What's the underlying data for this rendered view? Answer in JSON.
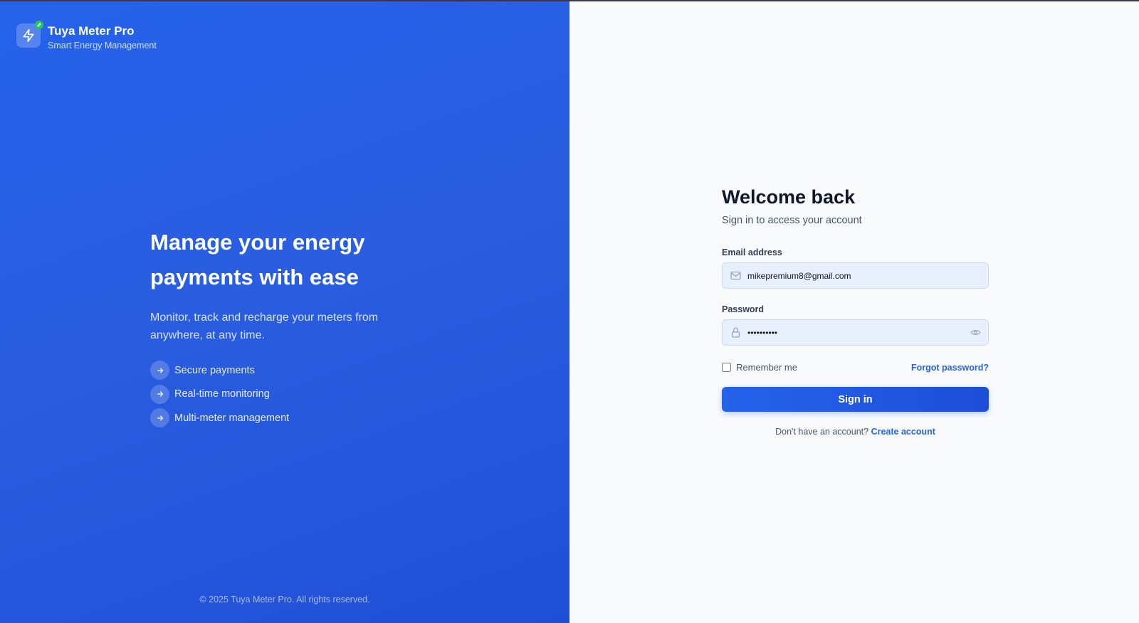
{
  "brand": {
    "title": "Tuya Meter Pro",
    "subtitle": "Smart Energy Management",
    "logo_icon": "lightning-bolt-icon",
    "badge_icon": "link-icon",
    "badge_color": "#22c55e"
  },
  "hero": {
    "headline": "Manage your energy payments with ease",
    "description": "Monitor, track and recharge your meters from anywhere, at any time.",
    "features": [
      {
        "label": "Secure payments",
        "icon": "arrow-right-icon"
      },
      {
        "label": "Real-time monitoring",
        "icon": "arrow-right-icon"
      },
      {
        "label": "Multi-meter management",
        "icon": "arrow-right-icon"
      }
    ],
    "copyright": "© 2025 Tuya Meter Pro. All rights reserved.",
    "gradient_start": "#2563eb",
    "gradient_end": "#1f4fd6"
  },
  "login": {
    "title": "Welcome back",
    "subtitle": "Sign in to access your account",
    "email": {
      "label": "Email address",
      "value": "mikepremium8@gmail.com",
      "icon": "mail-icon"
    },
    "password": {
      "label": "Password",
      "value": "••••••••••",
      "icon": "lock-icon",
      "toggle_icon": "eye-icon"
    },
    "remember_label": "Remember me",
    "remember_checked": false,
    "forgot_label": "Forgot password?",
    "signin_label": "Sign in",
    "signup_prompt": "Don't have an account?",
    "signup_link": "Create account",
    "accent_color": "#2563eb"
  }
}
